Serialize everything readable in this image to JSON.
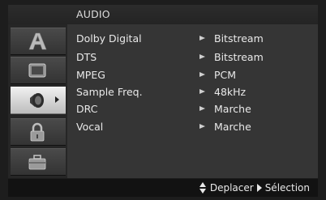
{
  "menu_title": "AUDIO",
  "tabs": [
    {
      "name": "language-tab",
      "icon": "letter-a-icon"
    },
    {
      "name": "display-tab",
      "icon": "tv-screen-icon"
    },
    {
      "name": "audio-tab",
      "icon": "speaker-icon",
      "active": true
    },
    {
      "name": "lock-tab",
      "icon": "padlock-icon"
    },
    {
      "name": "other-tab",
      "icon": "briefcase-icon"
    }
  ],
  "settings": [
    {
      "label": "Dolby Digital",
      "value": "Bitstream"
    },
    {
      "label": "DTS",
      "value": "Bitstream"
    },
    {
      "label": "MPEG",
      "value": "PCM"
    },
    {
      "label": "Sample Freq.",
      "value": "48kHz"
    },
    {
      "label": "DRC",
      "value": "Marche"
    },
    {
      "label": "Vocal",
      "value": "Marche"
    }
  ],
  "footer": {
    "move_label": "Deplacer",
    "select_label": "Sélection"
  }
}
